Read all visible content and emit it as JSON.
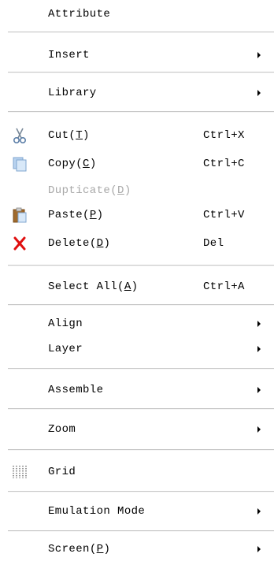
{
  "menu": {
    "items": [
      {
        "label": "Attribute"
      },
      {
        "label": "Insert"
      },
      {
        "label": "Library"
      },
      {
        "label": "Cut",
        "mnemonic": "T",
        "shortcut": "Ctrl+X",
        "icon": "scissors-icon"
      },
      {
        "label": "Copy",
        "mnemonic": "C",
        "shortcut": "Ctrl+C",
        "icon": "copy-icon"
      },
      {
        "label": "Dupticate",
        "mnemonic": "D",
        "disabled": true
      },
      {
        "label": "Paste",
        "mnemonic": "P",
        "shortcut": "Ctrl+V",
        "icon": "paste-icon"
      },
      {
        "label": "Delete",
        "mnemonic": "D",
        "shortcut": "Del",
        "icon": "delete-x-icon"
      },
      {
        "label": "Select All",
        "mnemonic": "A",
        "shortcut": "Ctrl+A"
      },
      {
        "label": "Align"
      },
      {
        "label": "Layer"
      },
      {
        "label": "Assemble"
      },
      {
        "label": "Zoom"
      },
      {
        "label": "Grid",
        "icon": "grid-icon"
      },
      {
        "label": "Emulation Mode"
      },
      {
        "label": "Screen",
        "mnemonic": "P"
      }
    ]
  },
  "colors": {
    "disabled_text": "#a8a8a8",
    "separator": "#c8c8c8",
    "delete_icon": "#e01010"
  }
}
